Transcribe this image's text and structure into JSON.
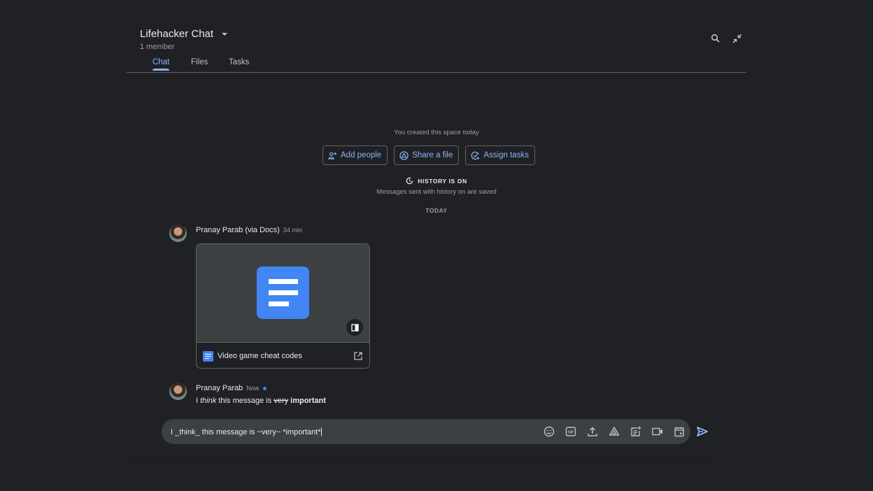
{
  "header": {
    "title": "Lifehacker Chat",
    "member_count": "1 member",
    "tabs": [
      {
        "label": "Chat",
        "active": true
      },
      {
        "label": "Files",
        "active": false
      },
      {
        "label": "Tasks",
        "active": false
      }
    ],
    "icons": [
      "search-icon",
      "collapse-icon"
    ]
  },
  "intro": {
    "created_text": "You created this space today",
    "actions": [
      {
        "label": "Add people",
        "icon": "add-person-icon"
      },
      {
        "label": "Share a file",
        "icon": "drive-icon"
      },
      {
        "label": "Assign tasks",
        "icon": "add-task-icon"
      }
    ],
    "history_label": "HISTORY IS ON",
    "history_sub": "Messages sent with history on are saved",
    "date_divider": "TODAY"
  },
  "messages": [
    {
      "sender": "Pranay Parab (via Docs)",
      "time": "34 min",
      "attachment": {
        "type": "google-doc",
        "title": "Video game cheat codes"
      }
    },
    {
      "sender": "Pranay Parab",
      "time": "Now",
      "unread_dot": true,
      "text_parts": {
        "p1": "I ",
        "italic": "think",
        "p2": " this message is ",
        "strike": "very",
        "p3": " ",
        "bold": "important"
      }
    }
  ],
  "composer": {
    "value": "I _think_ this message is ~very~ *important*",
    "tools": [
      "emoji-icon",
      "gif-icon",
      "upload-icon",
      "drive-icon",
      "new-doc-icon",
      "video-icon",
      "calendar-icon"
    ],
    "send_icon": "send-icon"
  },
  "colors": {
    "background": "#202124",
    "accent": "#8ab4f8",
    "doc_blue": "#4285f4",
    "composer_bg": "#3c4043"
  }
}
